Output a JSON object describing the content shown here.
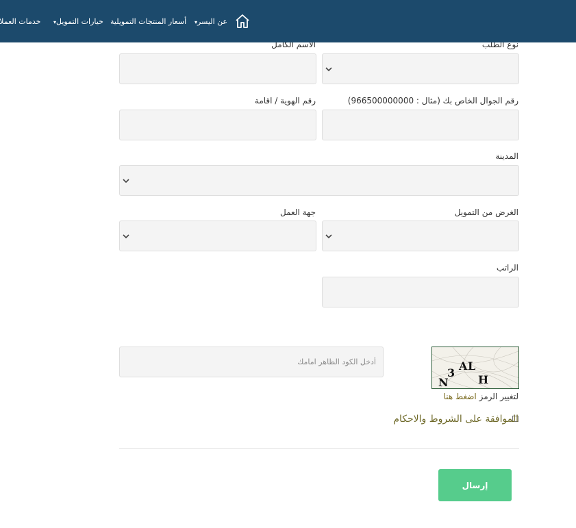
{
  "nav": {
    "items": [
      "عن اليسر",
      "أسعار المنتجات التمويلية",
      "خيارات التمويل",
      "خدمات العملاء"
    ],
    "home_icon": "home-icon"
  },
  "form": {
    "request_type_label": "نوع الطلب",
    "full_name_label": "الاسم الكامل",
    "mobile_label": "رقم الجوال الخاص بك (مثال : 966500000000)",
    "id_label": "رقم الهوية / اقامة",
    "city_label": "المدينة",
    "purpose_label": "الغرض من التمويل",
    "employer_label": "جهة العمل",
    "salary_label": "الراتب",
    "captcha_placeholder": "أدخل الكود الظاهر امامك",
    "captcha_text": [
      "N",
      "3",
      "A",
      "L",
      "H"
    ],
    "refresh_prefix": "لتغيير الرمز",
    "refresh_link": "اضغط هنا",
    "terms_label": "الموافقة على الشروط والاحكام",
    "submit_label": "إرسال"
  },
  "colors": {
    "navbar": "#1c4a6c",
    "submit": "#56cc8c",
    "terms": "#6f6a2a"
  }
}
